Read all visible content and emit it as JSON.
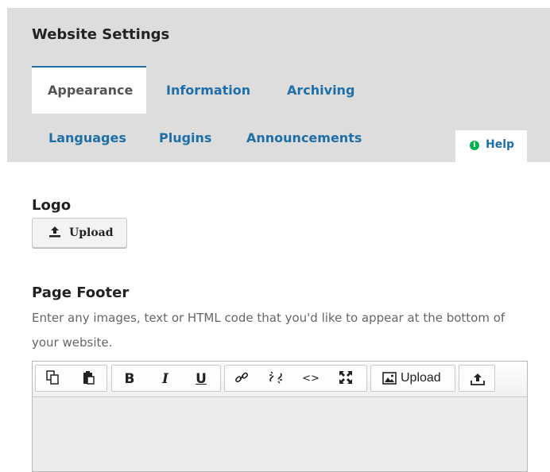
{
  "header": {
    "title": "Website Settings",
    "tabs": [
      {
        "label": "Appearance",
        "active": true
      },
      {
        "label": "Information"
      },
      {
        "label": "Archiving"
      },
      {
        "label": "Languages"
      },
      {
        "label": "Plugins"
      },
      {
        "label": "Announcements"
      }
    ],
    "help": {
      "label": "Help",
      "icon": "info-circle-icon"
    }
  },
  "logo": {
    "title": "Logo",
    "upload_label": "Upload",
    "upload_icon": "upload-icon"
  },
  "footer": {
    "title": "Page Footer",
    "description": "Enter any images, text or HTML code that you'd like to appear at the bottom of your website.",
    "toolbar": {
      "buttons": [
        {
          "name": "copy",
          "icon": "copy-icon"
        },
        {
          "name": "paste",
          "icon": "paste-icon"
        },
        {
          "name": "bold",
          "label": "B"
        },
        {
          "name": "italic",
          "label": "I"
        },
        {
          "name": "underline",
          "label": "U"
        },
        {
          "name": "link",
          "icon": "link-icon"
        },
        {
          "name": "unlink",
          "icon": "unlink-icon"
        },
        {
          "name": "code",
          "label": "<>"
        },
        {
          "name": "fullscreen",
          "icon": "fullscreen-icon"
        },
        {
          "name": "image-upload",
          "label": "Upload",
          "icon": "image-icon"
        },
        {
          "name": "file-upload",
          "icon": "upload-icon"
        }
      ]
    },
    "content": ""
  },
  "colors": {
    "accent": "#1e6fa7",
    "header_bg": "#dddddd",
    "help_icon": "#00b24e"
  }
}
